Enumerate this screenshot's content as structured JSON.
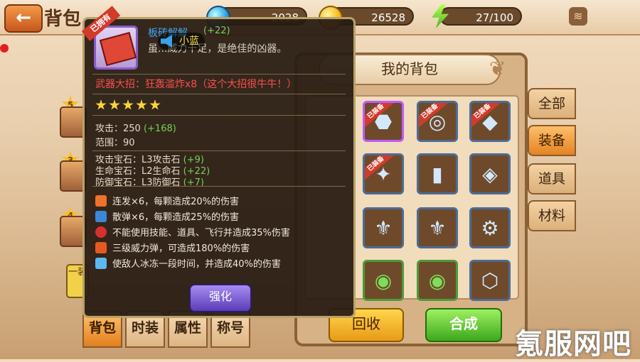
{
  "header": {
    "back_arrow": "←",
    "title": "背包",
    "gems": "2028",
    "coins": "26528",
    "energy": "27/100",
    "wifi_icon": "wifi-icon"
  },
  "bag": {
    "title": "我的背包",
    "categories": [
      "全部",
      "装备",
      "道具",
      "材料"
    ],
    "active_category": "装备",
    "equipped_tag": "已装备",
    "slots": [
      {
        "glyph": "⬣",
        "equipped": true
      },
      {
        "glyph": "◎",
        "equipped": true
      },
      {
        "glyph": "◆",
        "equipped": true
      },
      {
        "glyph": "✦",
        "equipped": true
      },
      {
        "glyph": "▮",
        "equipped": false
      },
      {
        "glyph": "◈",
        "equipped": false
      },
      {
        "glyph": "⚜",
        "equipped": false
      },
      {
        "glyph": "⚜",
        "equipped": false
      },
      {
        "glyph": "⚙",
        "equipped": false
      },
      {
        "glyph": "◉",
        "equipped": false
      },
      {
        "glyph": "◉",
        "equipped": false
      },
      {
        "glyph": "⬡",
        "equipped": false
      }
    ],
    "recycle_label": "回收",
    "combine_label": "合成"
  },
  "bottom_tabs": [
    "背包",
    "时装",
    "属性",
    "称号"
  ],
  "left_side": {
    "levels": [
      "5",
      "3",
      "4"
    ],
    "equip_label": "一装"
  },
  "tooltip": {
    "owned_tag": "已拥有",
    "name": "板砖解解",
    "name_extra": "(+22)",
    "chat_text": "小蓝",
    "description": "虽...威力十足，是绝佳的凶器。",
    "ultimate": "武器大招：狂轰滥炸x8（这个大招很牛牛！）",
    "star_count": 5,
    "attack_label": "攻击：250",
    "attack_bonus": "(+168)",
    "range_label": "范围：90",
    "attack_gem": "攻击宝石：L3攻击石",
    "attack_gem_bonus": "(+9)",
    "life_gem": "生命宝石：L2生命石",
    "life_gem_bonus": "(+22)",
    "defense_gem": "防御宝石：L3防御石",
    "defense_gem_bonus": "(+7)",
    "skills": [
      {
        "text": "连发×6，每颗造成20%的伤害",
        "icon": "burst-fire-icon",
        "color": "#f0722a"
      },
      {
        "text": "散弹×6，每颗造成25%的伤害",
        "icon": "scatter-shot-icon",
        "color": "#3a88d8"
      },
      {
        "text": "不能使用技能、道具、飞行并造成35%伤害",
        "icon": "silence-magnet-icon",
        "color": "#d83030"
      },
      {
        "text": "三级威力弹，可造成180%的伤害",
        "icon": "power-bomb-icon",
        "color": "#e55a22"
      },
      {
        "text": "使敌人冰冻一段时间，并造成40%的伤害",
        "icon": "freeze-icon",
        "color": "#5cb8f0"
      }
    ],
    "strengthen_label": "强化"
  },
  "watermark": "氪服网吧",
  "colors": {
    "accent_orange": "#e38322",
    "tooltip_bg": "#281c12",
    "equipped_red": "#d23a2a",
    "bonus_green": "#7ad05a"
  }
}
